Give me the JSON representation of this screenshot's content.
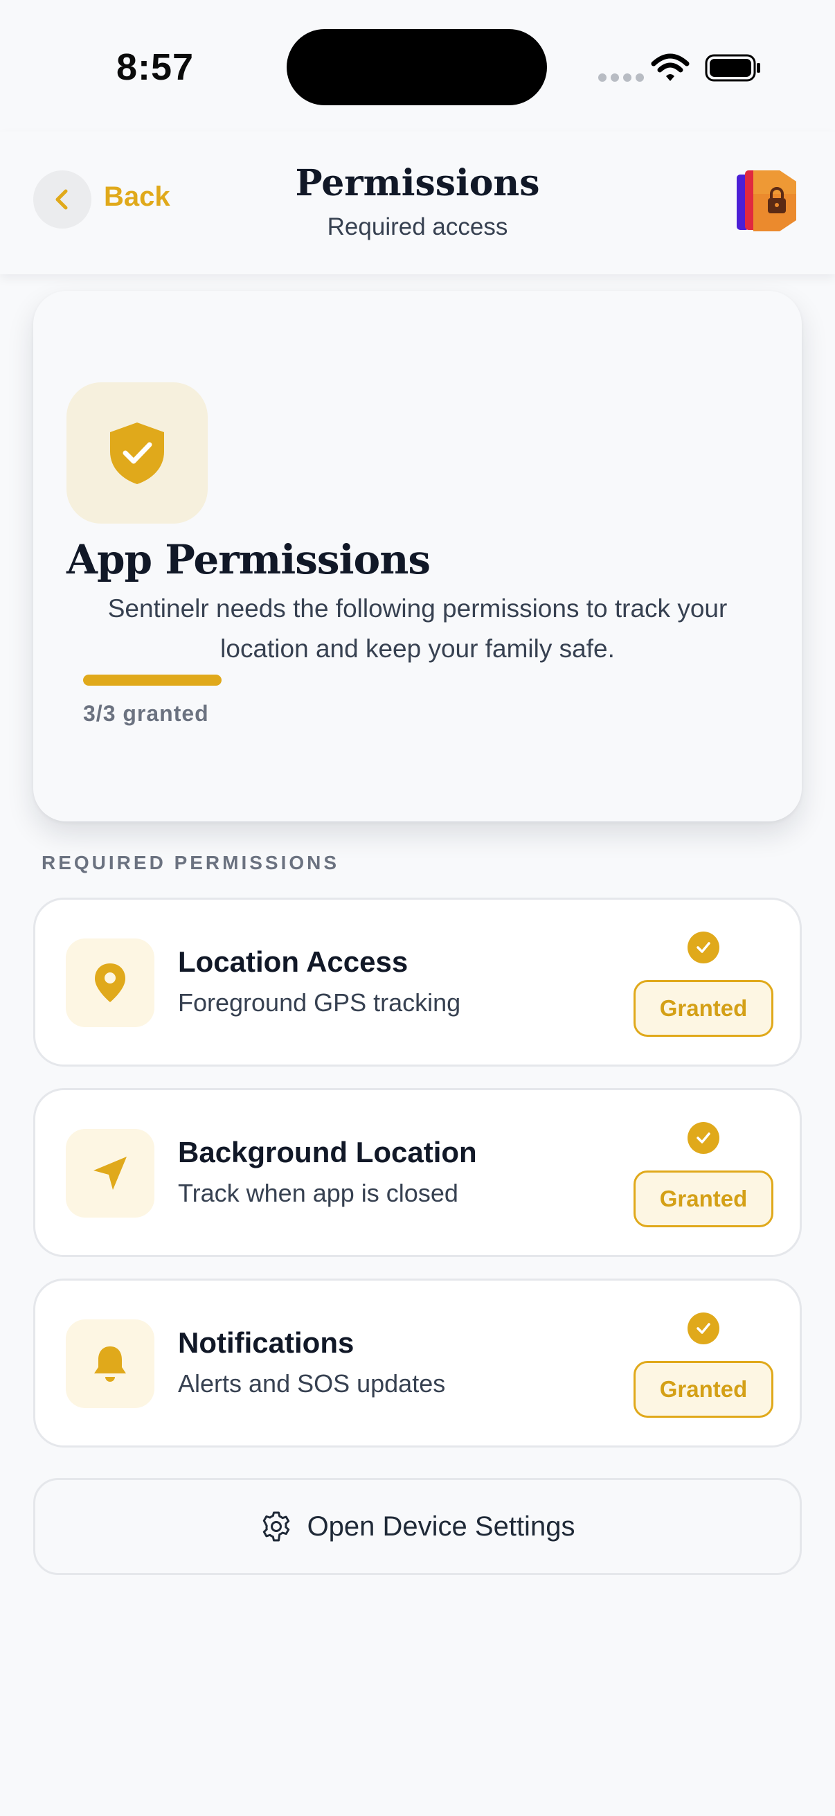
{
  "status_bar": {
    "time": "8:57"
  },
  "header": {
    "back_label": "Back",
    "title": "Permissions",
    "subtitle": "Required access"
  },
  "hero": {
    "title": "App Permissions",
    "description": "Sentinelr needs the following permissions to track your location and keep your family safe.",
    "progress_fraction": 1.0,
    "progress_label": "3/3 granted"
  },
  "section_label": "REQUIRED PERMISSIONS",
  "permissions": [
    {
      "title": "Location Access",
      "subtitle": "Foreground GPS tracking",
      "status": "Granted",
      "icon": "location-pin-icon"
    },
    {
      "title": "Background Location",
      "subtitle": "Track when app is closed",
      "status": "Granted",
      "icon": "navigation-arrow-icon"
    },
    {
      "title": "Notifications",
      "subtitle": "Alerts and SOS updates",
      "status": "Granted",
      "icon": "bell-icon"
    }
  ],
  "settings_button": {
    "label": "Open Device Settings",
    "icon": "gear-icon"
  },
  "colors": {
    "accent": "#e0a91b",
    "accent_soft": "#fdf6e3",
    "text": "#111827",
    "muted": "#6b7280",
    "background": "#f8f9fb"
  }
}
